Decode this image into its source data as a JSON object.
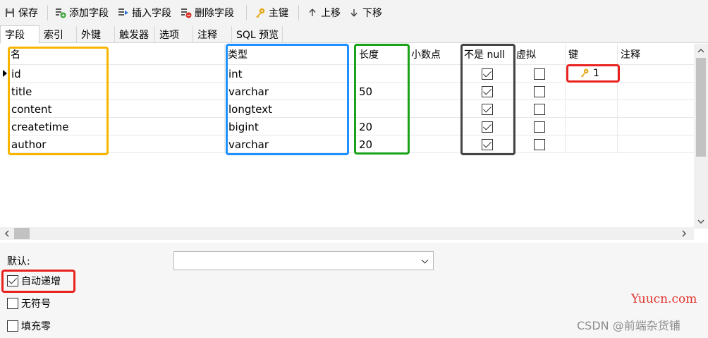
{
  "toolbar": {
    "save": "保存",
    "add_field": "添加字段",
    "insert_field": "插入字段",
    "delete_field": "删除字段",
    "primary_key": "主键",
    "move_up": "上移",
    "move_down": "下移"
  },
  "tabs": [
    "字段",
    "索引",
    "外键",
    "触发器",
    "选项",
    "注释",
    "SQL 预览"
  ],
  "columns": {
    "name": "名",
    "type": "类型",
    "length": "长度",
    "decimal": "小数点",
    "not_null": "不是 null",
    "virtual": "虚拟",
    "key": "键",
    "comment": "注释"
  },
  "rows": [
    {
      "name": "id",
      "type": "int",
      "length": "",
      "not_null": true,
      "virtual": false,
      "key": "1"
    },
    {
      "name": "title",
      "type": "varchar",
      "length": "50",
      "not_null": true,
      "virtual": false,
      "key": ""
    },
    {
      "name": "content",
      "type": "longtext",
      "length": "",
      "not_null": true,
      "virtual": false,
      "key": ""
    },
    {
      "name": "createtime",
      "type": "bigint",
      "length": "20",
      "not_null": true,
      "virtual": false,
      "key": ""
    },
    {
      "name": "author",
      "type": "varchar",
      "length": "20",
      "not_null": true,
      "virtual": false,
      "key": ""
    }
  ],
  "options": {
    "default_label": "默认:",
    "default_value": "",
    "auto_increment": {
      "label": "自动递增",
      "checked": true
    },
    "unsigned": {
      "label": "无符号",
      "checked": false
    },
    "zerofill": {
      "label": "填充零",
      "checked": false
    }
  },
  "watermark": {
    "site": "Yuucn.com",
    "author": "CSDN @前端杂货铺"
  },
  "highlight_colors": {
    "name_col": "#f7b500",
    "type_col": "#1e90ff",
    "length_col": "#1aa31a",
    "not_null_col": "#444444",
    "key_cell": "#e8231f",
    "auto_increment": "#e8231f"
  }
}
